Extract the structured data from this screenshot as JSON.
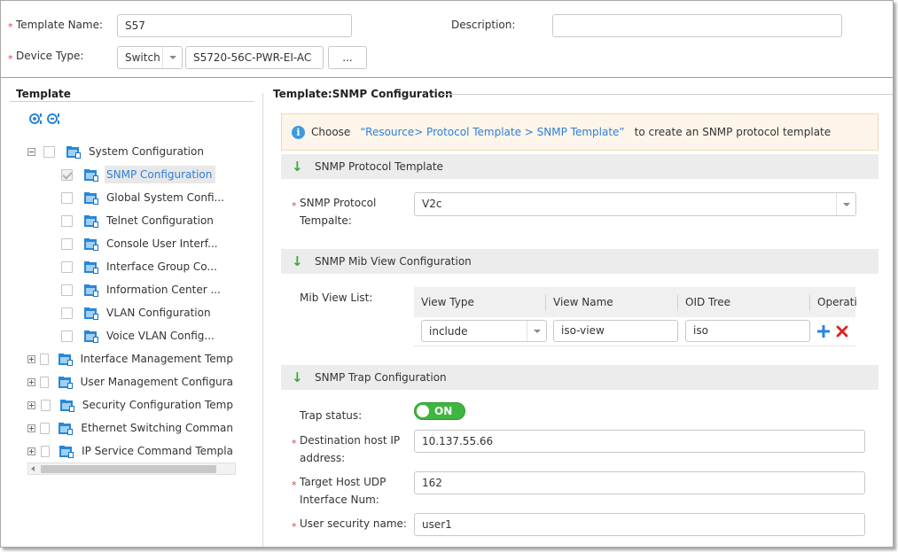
{
  "header": {
    "template_name_label": "Template Name:",
    "template_name_value": "S57",
    "description_label": "Description:",
    "description_value": "",
    "device_type_label": "Device Type:",
    "device_type_value": "Switch",
    "device_model_value": "S5720-56C-PWR-EI-AC",
    "browse_button_label": "..."
  },
  "left_panel": {
    "title": "Template",
    "expand_icon": "expand-all-icon",
    "collapse_icon": "collapse-all-icon",
    "tree": [
      {
        "label": "System Configuration",
        "level": 0,
        "expander": "minus",
        "checked": false
      },
      {
        "label": "SNMP Configuration",
        "level": 1,
        "checked": true,
        "selected": true
      },
      {
        "label": "Global System Confi...",
        "level": 1,
        "checked": false
      },
      {
        "label": "Telnet Configuration",
        "level": 1,
        "checked": false
      },
      {
        "label": "Console User Interf...",
        "level": 1,
        "checked": false
      },
      {
        "label": "Interface Group Co...",
        "level": 1,
        "checked": false
      },
      {
        "label": "Information Center ...",
        "level": 1,
        "checked": false
      },
      {
        "label": "VLAN Configuration",
        "level": 1,
        "checked": false
      },
      {
        "label": "Voice VLAN Config...",
        "level": 1,
        "checked": false
      },
      {
        "label": "Interface Management Temp",
        "level": 0,
        "expander": "plus",
        "checked": false
      },
      {
        "label": "User Management Configura",
        "level": 0,
        "expander": "plus",
        "checked": false
      },
      {
        "label": "Security Configuration Temp",
        "level": 0,
        "expander": "plus",
        "checked": false
      },
      {
        "label": "Ethernet Switching Comman",
        "level": 0,
        "expander": "plus",
        "checked": false
      },
      {
        "label": "IP Service Command Templa",
        "level": 0,
        "expander": "plus",
        "checked": false
      }
    ]
  },
  "right_panel": {
    "title": "Template:SNMP Configuration",
    "info": {
      "prefix": "Choose",
      "link": "“Resource> Protocol Template > SNMP Template”",
      "suffix": "to create an SNMP protocol template"
    },
    "sections": {
      "protocol": "SNMP Protocol Template",
      "mib": "SNMP Mib View Configuration",
      "trap": "SNMP Trap Configuration"
    },
    "protocol_label_line1": "SNMP Protocol",
    "protocol_label_line2": "Tempalte:",
    "protocol_value": "V2c",
    "mib_view_list_label": "Mib View List:",
    "mib_table": {
      "headers": [
        "View Type",
        "View Name",
        "OID Tree",
        "Operati"
      ],
      "rows": [
        {
          "view_type": "include",
          "view_name": "iso-view",
          "oid_tree": "iso"
        }
      ]
    },
    "trap_status_label": "Trap status:",
    "trap_status_value": "ON",
    "dest_ip_label_line1": "Destination host IP",
    "dest_ip_label_line2": "address:",
    "dest_ip_value": "10.137.55.66",
    "udp_label_line1": "Target Host UDP",
    "udp_label_line2": "Interface Num:",
    "udp_value": "162",
    "security_name_label": "User security name:",
    "security_name_value": "user1"
  },
  "colors": {
    "required": "#e0403c",
    "link": "#2f7fd8",
    "toggle_on": "#3fb63f",
    "add": "#2a86d6",
    "delete": "#e02020",
    "section_arrow": "#3aa93a",
    "info_icon": "#3c9be0"
  }
}
